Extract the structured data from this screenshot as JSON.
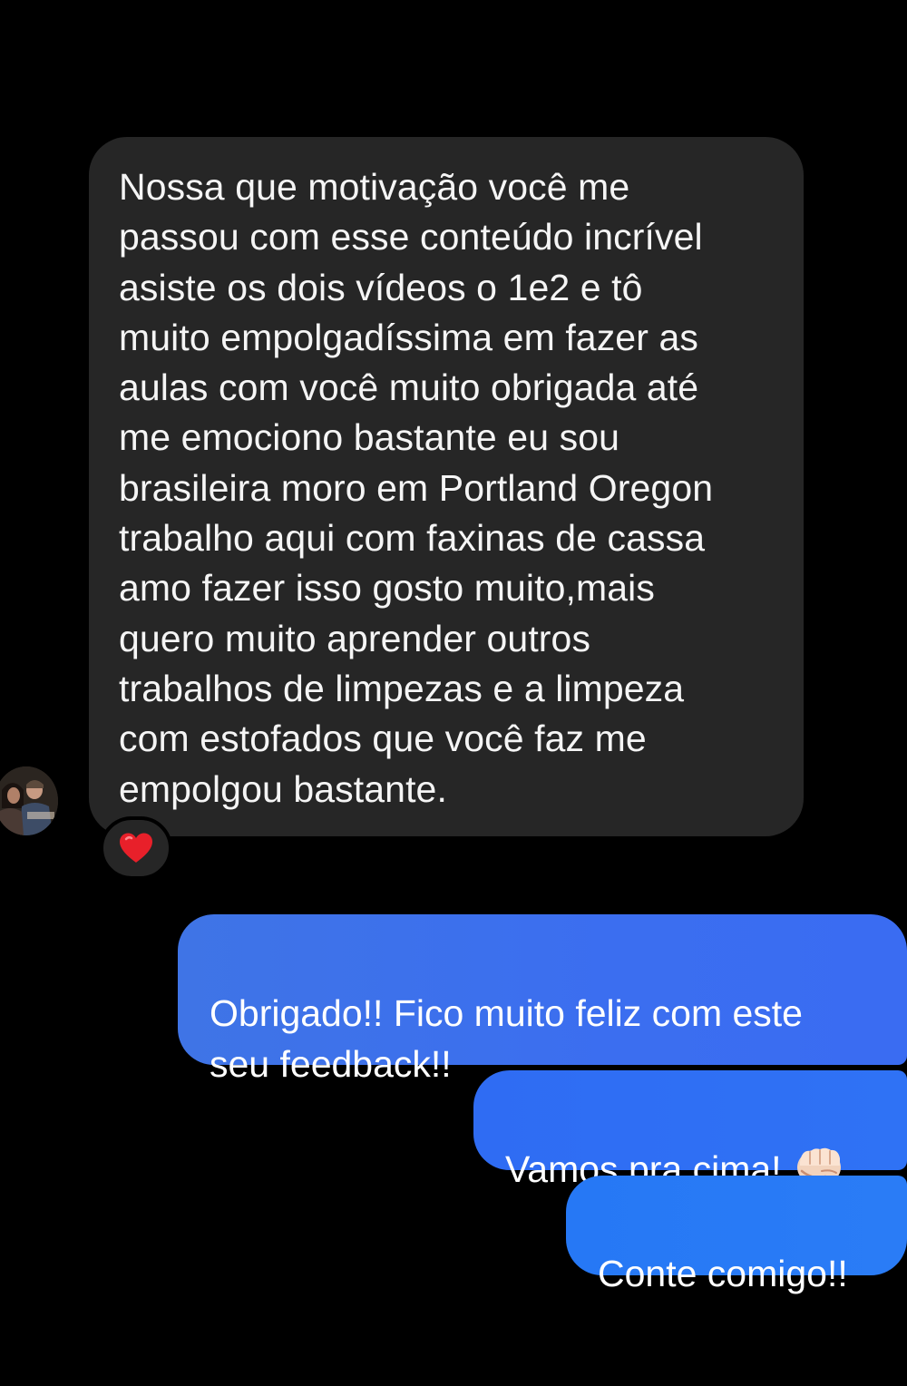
{
  "messages": {
    "incoming": {
      "text": "Nossa que motivação você me\npassou com esse conteúdo incrível\nasiste os dois vídeos o 1e2 e tô\nmuito empolgadíssima em fazer as\naulas com você muito obrigada até\nme emociono bastante eu sou\nbrasileira moro em Portland Oregon\ntrabalho aqui com faxinas de cassa\namo fazer isso gosto muito,mais\nquero muito aprender outros\ntrabalhos de limpezas e a limpeza\ncom estofados que você faz me\nempolgou bastante.",
      "reaction": "heart-icon",
      "avatar": "avatar"
    },
    "outgoing": [
      {
        "text": "Obrigado!! Fico muito feliz com este\nseu feedback!!"
      },
      {
        "text": "Vamos pra cima!",
        "emoji": "oncoming-fist-icon"
      },
      {
        "text": "Conte comigo!!"
      }
    ]
  },
  "colors": {
    "background": "#000000",
    "incoming_bubble": "#262626",
    "outgoing_bubble_top": "#3d70ec",
    "outgoing_bubble_bottom": "#2a7cf6",
    "reaction_heart": "#e8202a"
  }
}
